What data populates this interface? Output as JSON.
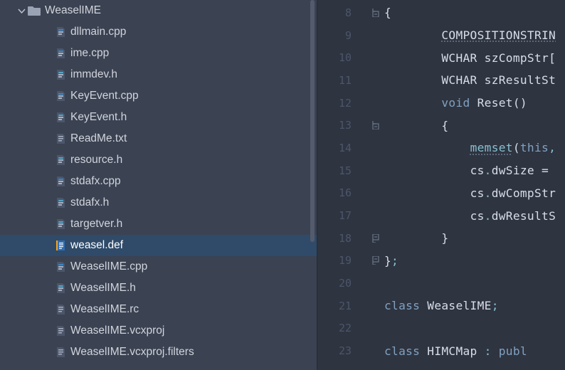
{
  "tree": {
    "folder_name": "WeaselIME",
    "selected_index": 10,
    "items": [
      {
        "label": "dllmain.cpp",
        "icon": "cpp"
      },
      {
        "label": "ime.cpp",
        "icon": "cpp"
      },
      {
        "label": "immdev.h",
        "icon": "h"
      },
      {
        "label": "KeyEvent.cpp",
        "icon": "cpp"
      },
      {
        "label": "KeyEvent.h",
        "icon": "h"
      },
      {
        "label": "ReadMe.txt",
        "icon": "txt"
      },
      {
        "label": "resource.h",
        "icon": "h"
      },
      {
        "label": "stdafx.cpp",
        "icon": "cpp"
      },
      {
        "label": "stdafx.h",
        "icon": "h"
      },
      {
        "label": "targetver.h",
        "icon": "h"
      },
      {
        "label": "weasel.def",
        "icon": "def"
      },
      {
        "label": "WeaselIME.cpp",
        "icon": "cpp"
      },
      {
        "label": "WeaselIME.h",
        "icon": "h"
      },
      {
        "label": "WeaselIME.rc",
        "icon": "txt"
      },
      {
        "label": "WeaselIME.vcxproj",
        "icon": "txt"
      },
      {
        "label": "WeaselIME.vcxproj.filters",
        "icon": "txt"
      }
    ]
  },
  "editor": {
    "first_line_number": 8,
    "lines": [
      {
        "indent": 0,
        "fold": "open-down",
        "raw": "{",
        "segments": [
          {
            "text": "{",
            "cls": "tok-brace"
          }
        ]
      },
      {
        "indent": 2,
        "fold": "",
        "raw": "COMPOSITIONSTRIN",
        "segments": [
          {
            "text": "COMPOSITIONSTRIN",
            "cls": "tok-ident tok-underline"
          }
        ]
      },
      {
        "indent": 2,
        "fold": "",
        "raw": "WCHAR szCompStr[",
        "segments": [
          {
            "text": "WCHAR ",
            "cls": "tok-type"
          },
          {
            "text": "szCompStr",
            "cls": "tok-ident"
          },
          {
            "text": "[",
            "cls": "tok-brace"
          }
        ]
      },
      {
        "indent": 2,
        "fold": "",
        "raw": "WCHAR szResultSt",
        "segments": [
          {
            "text": "WCHAR ",
            "cls": "tok-type"
          },
          {
            "text": "szResultSt",
            "cls": "tok-ident"
          }
        ]
      },
      {
        "indent": 2,
        "fold": "",
        "raw": "void Reset()",
        "segments": [
          {
            "text": "void ",
            "cls": "tok-kw"
          },
          {
            "text": "Reset",
            "cls": "tok-ident"
          },
          {
            "text": "()",
            "cls": "tok-paren"
          }
        ]
      },
      {
        "indent": 2,
        "fold": "open-down",
        "raw": "{",
        "segments": [
          {
            "text": "{",
            "cls": "tok-brace"
          }
        ]
      },
      {
        "indent": 3,
        "fold": "",
        "raw": "memset(this,",
        "segments": [
          {
            "text": "memset",
            "cls": "tok-call tok-underline"
          },
          {
            "text": "(",
            "cls": "tok-paren"
          },
          {
            "text": "this",
            "cls": "tok-this"
          },
          {
            "text": ",",
            "cls": "tok-punc"
          }
        ]
      },
      {
        "indent": 3,
        "fold": "",
        "raw": "cs.dwSize = ",
        "segments": [
          {
            "text": "cs",
            "cls": "tok-ident"
          },
          {
            "text": ".",
            "cls": "tok-punc"
          },
          {
            "text": "dwSize ",
            "cls": "tok-ident"
          },
          {
            "text": "= ",
            "cls": "tok-ident"
          }
        ]
      },
      {
        "indent": 3,
        "fold": "",
        "raw": "cs.dwCompStr",
        "segments": [
          {
            "text": "cs",
            "cls": "tok-ident"
          },
          {
            "text": ".",
            "cls": "tok-punc"
          },
          {
            "text": "dwCompStr",
            "cls": "tok-ident"
          }
        ]
      },
      {
        "indent": 3,
        "fold": "",
        "raw": "cs.dwResultS",
        "segments": [
          {
            "text": "cs",
            "cls": "tok-ident"
          },
          {
            "text": ".",
            "cls": "tok-punc"
          },
          {
            "text": "dwResultS",
            "cls": "tok-ident"
          }
        ]
      },
      {
        "indent": 2,
        "fold": "close-up",
        "raw": "}",
        "segments": [
          {
            "text": "}",
            "cls": "tok-brace"
          }
        ]
      },
      {
        "indent": 0,
        "fold": "close-up",
        "raw": "};",
        "segments": [
          {
            "text": "}",
            "cls": "tok-brace"
          },
          {
            "text": ";",
            "cls": "tok-punc"
          }
        ]
      },
      {
        "indent": 0,
        "fold": "",
        "raw": "",
        "segments": []
      },
      {
        "indent": 0,
        "fold": "",
        "raw": "class WeaselIME;",
        "segments": [
          {
            "text": "class ",
            "cls": "tok-kw"
          },
          {
            "text": "WeaselIME",
            "cls": "tok-ident"
          },
          {
            "text": ";",
            "cls": "tok-punc"
          }
        ]
      },
      {
        "indent": 0,
        "fold": "",
        "raw": "",
        "segments": []
      },
      {
        "indent": 0,
        "fold": "",
        "raw": "class HIMCMap : publ",
        "segments": [
          {
            "text": "class ",
            "cls": "tok-kw"
          },
          {
            "text": "HIMCMap ",
            "cls": "tok-ident"
          },
          {
            "text": ": ",
            "cls": "tok-punc"
          },
          {
            "text": "publ",
            "cls": "tok-kw"
          }
        ]
      }
    ]
  }
}
